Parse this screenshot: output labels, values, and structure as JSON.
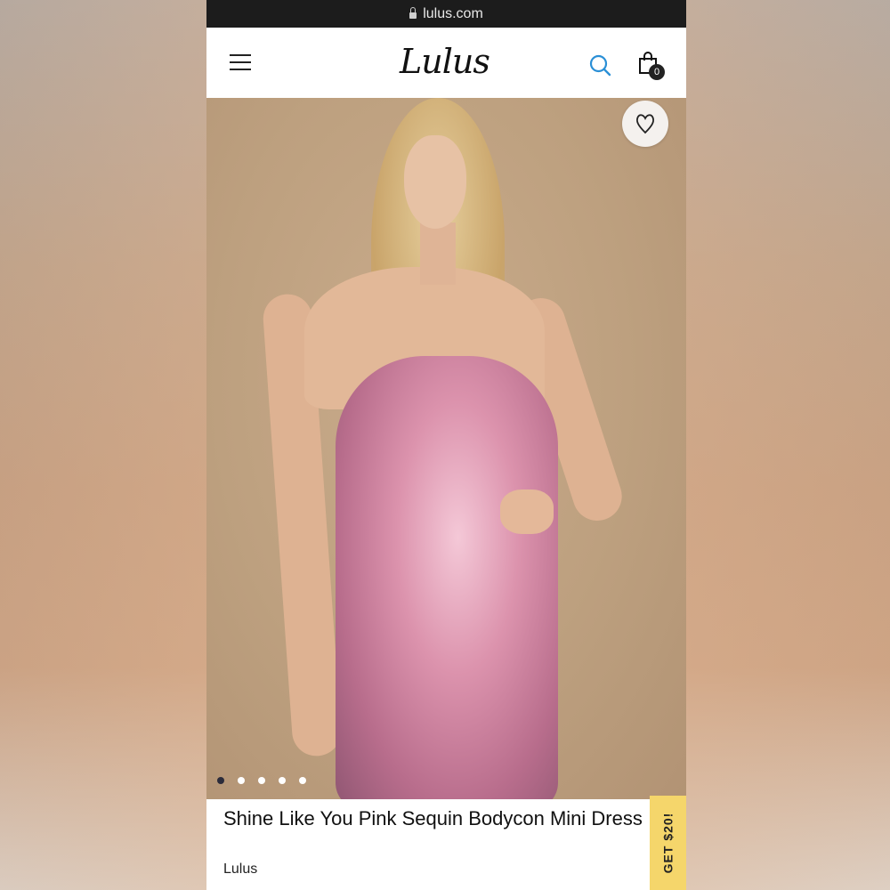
{
  "browser": {
    "url": "lulus.com",
    "lock_icon": "lock-icon"
  },
  "header": {
    "logo": "Lulus",
    "menu_icon": "hamburger-menu-icon",
    "search_icon": "search-icon",
    "bag_icon": "shopping-bag-icon",
    "bag_count": "0",
    "search_color": "#2a8fd6"
  },
  "product": {
    "title": "Shine Like You Pink Sequin Bodycon Mini Dress",
    "brand": "Lulus",
    "wishlist_icon": "heart-icon",
    "image_count": 5,
    "active_image_index": 0
  },
  "promo": {
    "label": "GET $20!",
    "color": "#f5d66b"
  }
}
